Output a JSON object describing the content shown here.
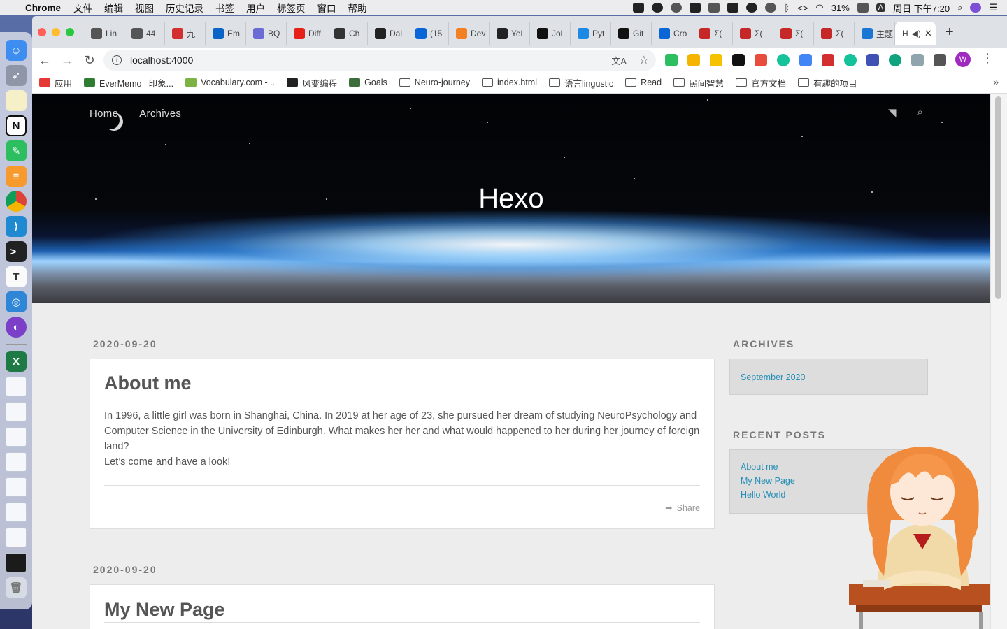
{
  "menubar": {
    "app_name": "Chrome",
    "menus": [
      "文件",
      "编辑",
      "视图",
      "历史记录",
      "书签",
      "用户",
      "标签页",
      "窗口",
      "帮助"
    ],
    "battery": "31%",
    "input_method": "A",
    "clock": "周日 下午7:20"
  },
  "browser": {
    "tabs": [
      {
        "label": "Lin",
        "icon": "globe-icon",
        "color": "#555555"
      },
      {
        "label": "44",
        "icon": "globe-icon",
        "color": "#555555"
      },
      {
        "label": "九",
        "icon": "pdf-icon",
        "color": "#d32f2f"
      },
      {
        "label": "Em",
        "icon": "outlook-icon",
        "color": "#0a64c8"
      },
      {
        "label": "BQ",
        "icon": "bot-icon",
        "color": "#6b6bd6"
      },
      {
        "label": "Diff",
        "icon": "youtube-icon",
        "color": "#e62117"
      },
      {
        "label": "Ch",
        "icon": "doc-icon",
        "color": "#333333"
      },
      {
        "label": "Dal",
        "icon": "globe-icon",
        "color": "#222222"
      },
      {
        "label": "(15",
        "icon": "zhihu-icon",
        "color": "#0a66d6"
      },
      {
        "label": "Dev",
        "icon": "stack-icon",
        "color": "#f48024"
      },
      {
        "label": "Yel",
        "icon": "edit-icon",
        "color": "#222222"
      },
      {
        "label": "Jol",
        "icon": "github-icon",
        "color": "#111111"
      },
      {
        "label": "Pyt",
        "icon": "c-icon",
        "color": "#1e88e5"
      },
      {
        "label": "Git",
        "icon": "github-icon",
        "color": "#111111"
      },
      {
        "label": "Cro",
        "icon": "zhihu-icon",
        "color": "#0a66d6"
      },
      {
        "label": "Σ(",
        "icon": "sigma-icon",
        "color": "#c62828"
      },
      {
        "label": "Σ(",
        "icon": "sigma-icon",
        "color": "#c62828"
      },
      {
        "label": "Σ(",
        "icon": "sigma-icon",
        "color": "#c62828"
      },
      {
        "label": "Σ(",
        "icon": "sigma-icon",
        "color": "#c62828"
      },
      {
        "label": "主题",
        "icon": "hexo-icon",
        "color": "#1976d2"
      }
    ],
    "active_tab_label": "H",
    "url": "localhost:4000",
    "bookmarks": [
      {
        "label": "应用",
        "icon": "apps-grid-icon"
      },
      {
        "label": "EverMemo | 印象...",
        "icon": "evermemo-icon"
      },
      {
        "label": "Vocabulary.com -...",
        "icon": "vocabulary-icon"
      },
      {
        "label": "风变编程",
        "icon": "panda-icon"
      },
      {
        "label": "Goals",
        "icon": "mountain-icon"
      },
      {
        "label": "Neuro-journey",
        "icon": "folder-icon"
      },
      {
        "label": "index.html",
        "icon": "folder-icon"
      },
      {
        "label": "语言lingustic",
        "icon": "folder-icon"
      },
      {
        "label": "Read",
        "icon": "folder-icon"
      },
      {
        "label": "民间智慧",
        "icon": "folder-icon"
      },
      {
        "label": "官方文档",
        "icon": "folder-icon"
      },
      {
        "label": "有趣的项目",
        "icon": "folder-icon"
      }
    ],
    "profile_initial": "W"
  },
  "site": {
    "nav": [
      "Home",
      "Archives"
    ],
    "title": "Hexo"
  },
  "posts": [
    {
      "date": "2020-09-20",
      "title": "About me",
      "paragraphs": [
        "In 1996, a little girl was born in Shanghai, China. In 2019 at her age of 23, she pursued her dream of studying NeuroPsychology and Computer Science in the University of Edinburgh. What makes her her and what would happened to her during her journey of foreign land?",
        "Let’s come and have a look!"
      ],
      "share_label": "Share"
    },
    {
      "date": "2020-09-20",
      "title": "My New Page"
    }
  ],
  "sidebar": {
    "archives_title": "ARCHIVES",
    "archives": [
      "September 2020"
    ],
    "recent_title": "RECENT POSTS",
    "recent_posts": [
      "About me",
      "My New Page",
      "Hello World"
    ]
  },
  "colors": {
    "link": "#258fb8",
    "page_bg": "#ededed"
  }
}
